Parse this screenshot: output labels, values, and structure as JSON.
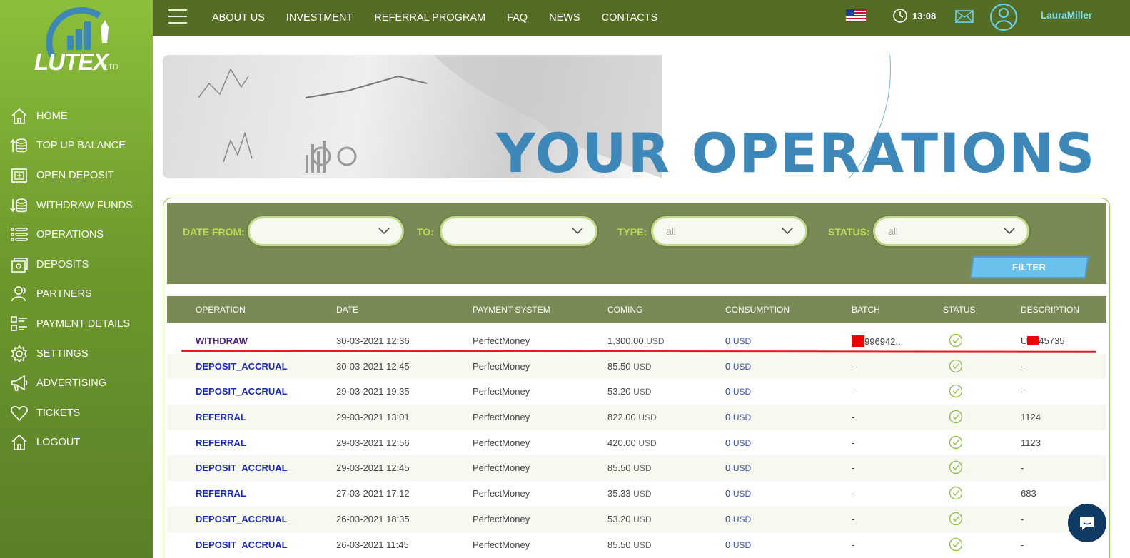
{
  "brand": {
    "name": "LUTEX",
    "suffix": "LTD"
  },
  "sidebar": {
    "items": [
      {
        "label": "HOME",
        "icon": "home-icon"
      },
      {
        "label": "TOP UP BALANCE",
        "icon": "coins-up-icon"
      },
      {
        "label": "OPEN DEPOSIT",
        "icon": "safe-icon"
      },
      {
        "label": "WITHDRAW FUNDS",
        "icon": "coins-down-icon"
      },
      {
        "label": "OPERATIONS",
        "icon": "list-icon"
      },
      {
        "label": "DEPOSITS",
        "icon": "wallet-icon"
      },
      {
        "label": "PARTNERS",
        "icon": "partners-icon"
      },
      {
        "label": "PAYMENT DETAILS",
        "icon": "payment-details-icon"
      },
      {
        "label": "SETTINGS",
        "icon": "gear-icon"
      },
      {
        "label": "ADVERTISING",
        "icon": "megaphone-icon"
      },
      {
        "label": "TICKETS",
        "icon": "heart-icon"
      },
      {
        "label": "LOGOUT",
        "icon": "logout-home-icon"
      }
    ]
  },
  "topnav": {
    "links": [
      "ABOUT US",
      "INVESTMENT",
      "REFERRAL PROGRAM",
      "FAQ",
      "NEWS",
      "CONTACTS"
    ],
    "time": "13:08",
    "username": "LauraMiller"
  },
  "banner": {
    "title": "YOUR OPERATIONS"
  },
  "filters": {
    "date_from_label": "DATE FROM:",
    "date_from_value": "",
    "to_label": "TO:",
    "to_value": "",
    "type_label": "TYPE:",
    "type_value": "all",
    "status_label": "STATUS:",
    "status_value": "all",
    "filter_button": "FILTER"
  },
  "table": {
    "headers": [
      "OPERATION",
      "DATE",
      "PAYMENT SYSTEM",
      "COMING",
      "CONSUMPTION",
      "BATCH",
      "STATUS",
      "DESCRIPTION"
    ],
    "rows": [
      {
        "operation": "WITHDRAW",
        "date": "30-03-2021 12:36",
        "system": "PerfectMoney",
        "coming": "1,300.00",
        "consumption": "0",
        "batch": "996942...",
        "description_pre": "U",
        "description": "45735"
      },
      {
        "operation": "DEPOSIT_ACCRUAL",
        "date": "30-03-2021 12:45",
        "system": "PerfectMoney",
        "coming": "85.50",
        "consumption": "0",
        "batch": "-",
        "description": "-"
      },
      {
        "operation": "DEPOSIT_ACCRUAL",
        "date": "29-03-2021 19:35",
        "system": "PerfectMoney",
        "coming": "53.20",
        "consumption": "0",
        "batch": "-",
        "description": "-"
      },
      {
        "operation": "REFERRAL",
        "date": "29-03-2021 13:01",
        "system": "PerfectMoney",
        "coming": "822.00",
        "consumption": "0",
        "batch": "-",
        "description": "1124"
      },
      {
        "operation": "REFERRAL",
        "date": "29-03-2021 12:56",
        "system": "PerfectMoney",
        "coming": "420.00",
        "consumption": "0",
        "batch": "-",
        "description": "1123"
      },
      {
        "operation": "DEPOSIT_ACCRUAL",
        "date": "29-03-2021 12:45",
        "system": "PerfectMoney",
        "coming": "85.50",
        "consumption": "0",
        "batch": "-",
        "description": "-"
      },
      {
        "operation": "REFERRAL",
        "date": "27-03-2021 17:12",
        "system": "PerfectMoney",
        "coming": "35.33",
        "consumption": "0",
        "batch": "-",
        "description": "683"
      },
      {
        "operation": "DEPOSIT_ACCRUAL",
        "date": "26-03-2021 18:35",
        "system": "PerfectMoney",
        "coming": "53.20",
        "consumption": "0",
        "batch": "-",
        "description": "-"
      },
      {
        "operation": "DEPOSIT_ACCRUAL",
        "date": "26-03-2021 11:45",
        "system": "PerfectMoney",
        "coming": "85.50",
        "consumption": "0",
        "batch": "-",
        "description": "-"
      }
    ],
    "currency": "USD"
  },
  "colors": {
    "sidebar": "#7aa832",
    "topbar": "#556c24",
    "accent": "#3d88b8",
    "filter_button": "#6cc1ec"
  }
}
